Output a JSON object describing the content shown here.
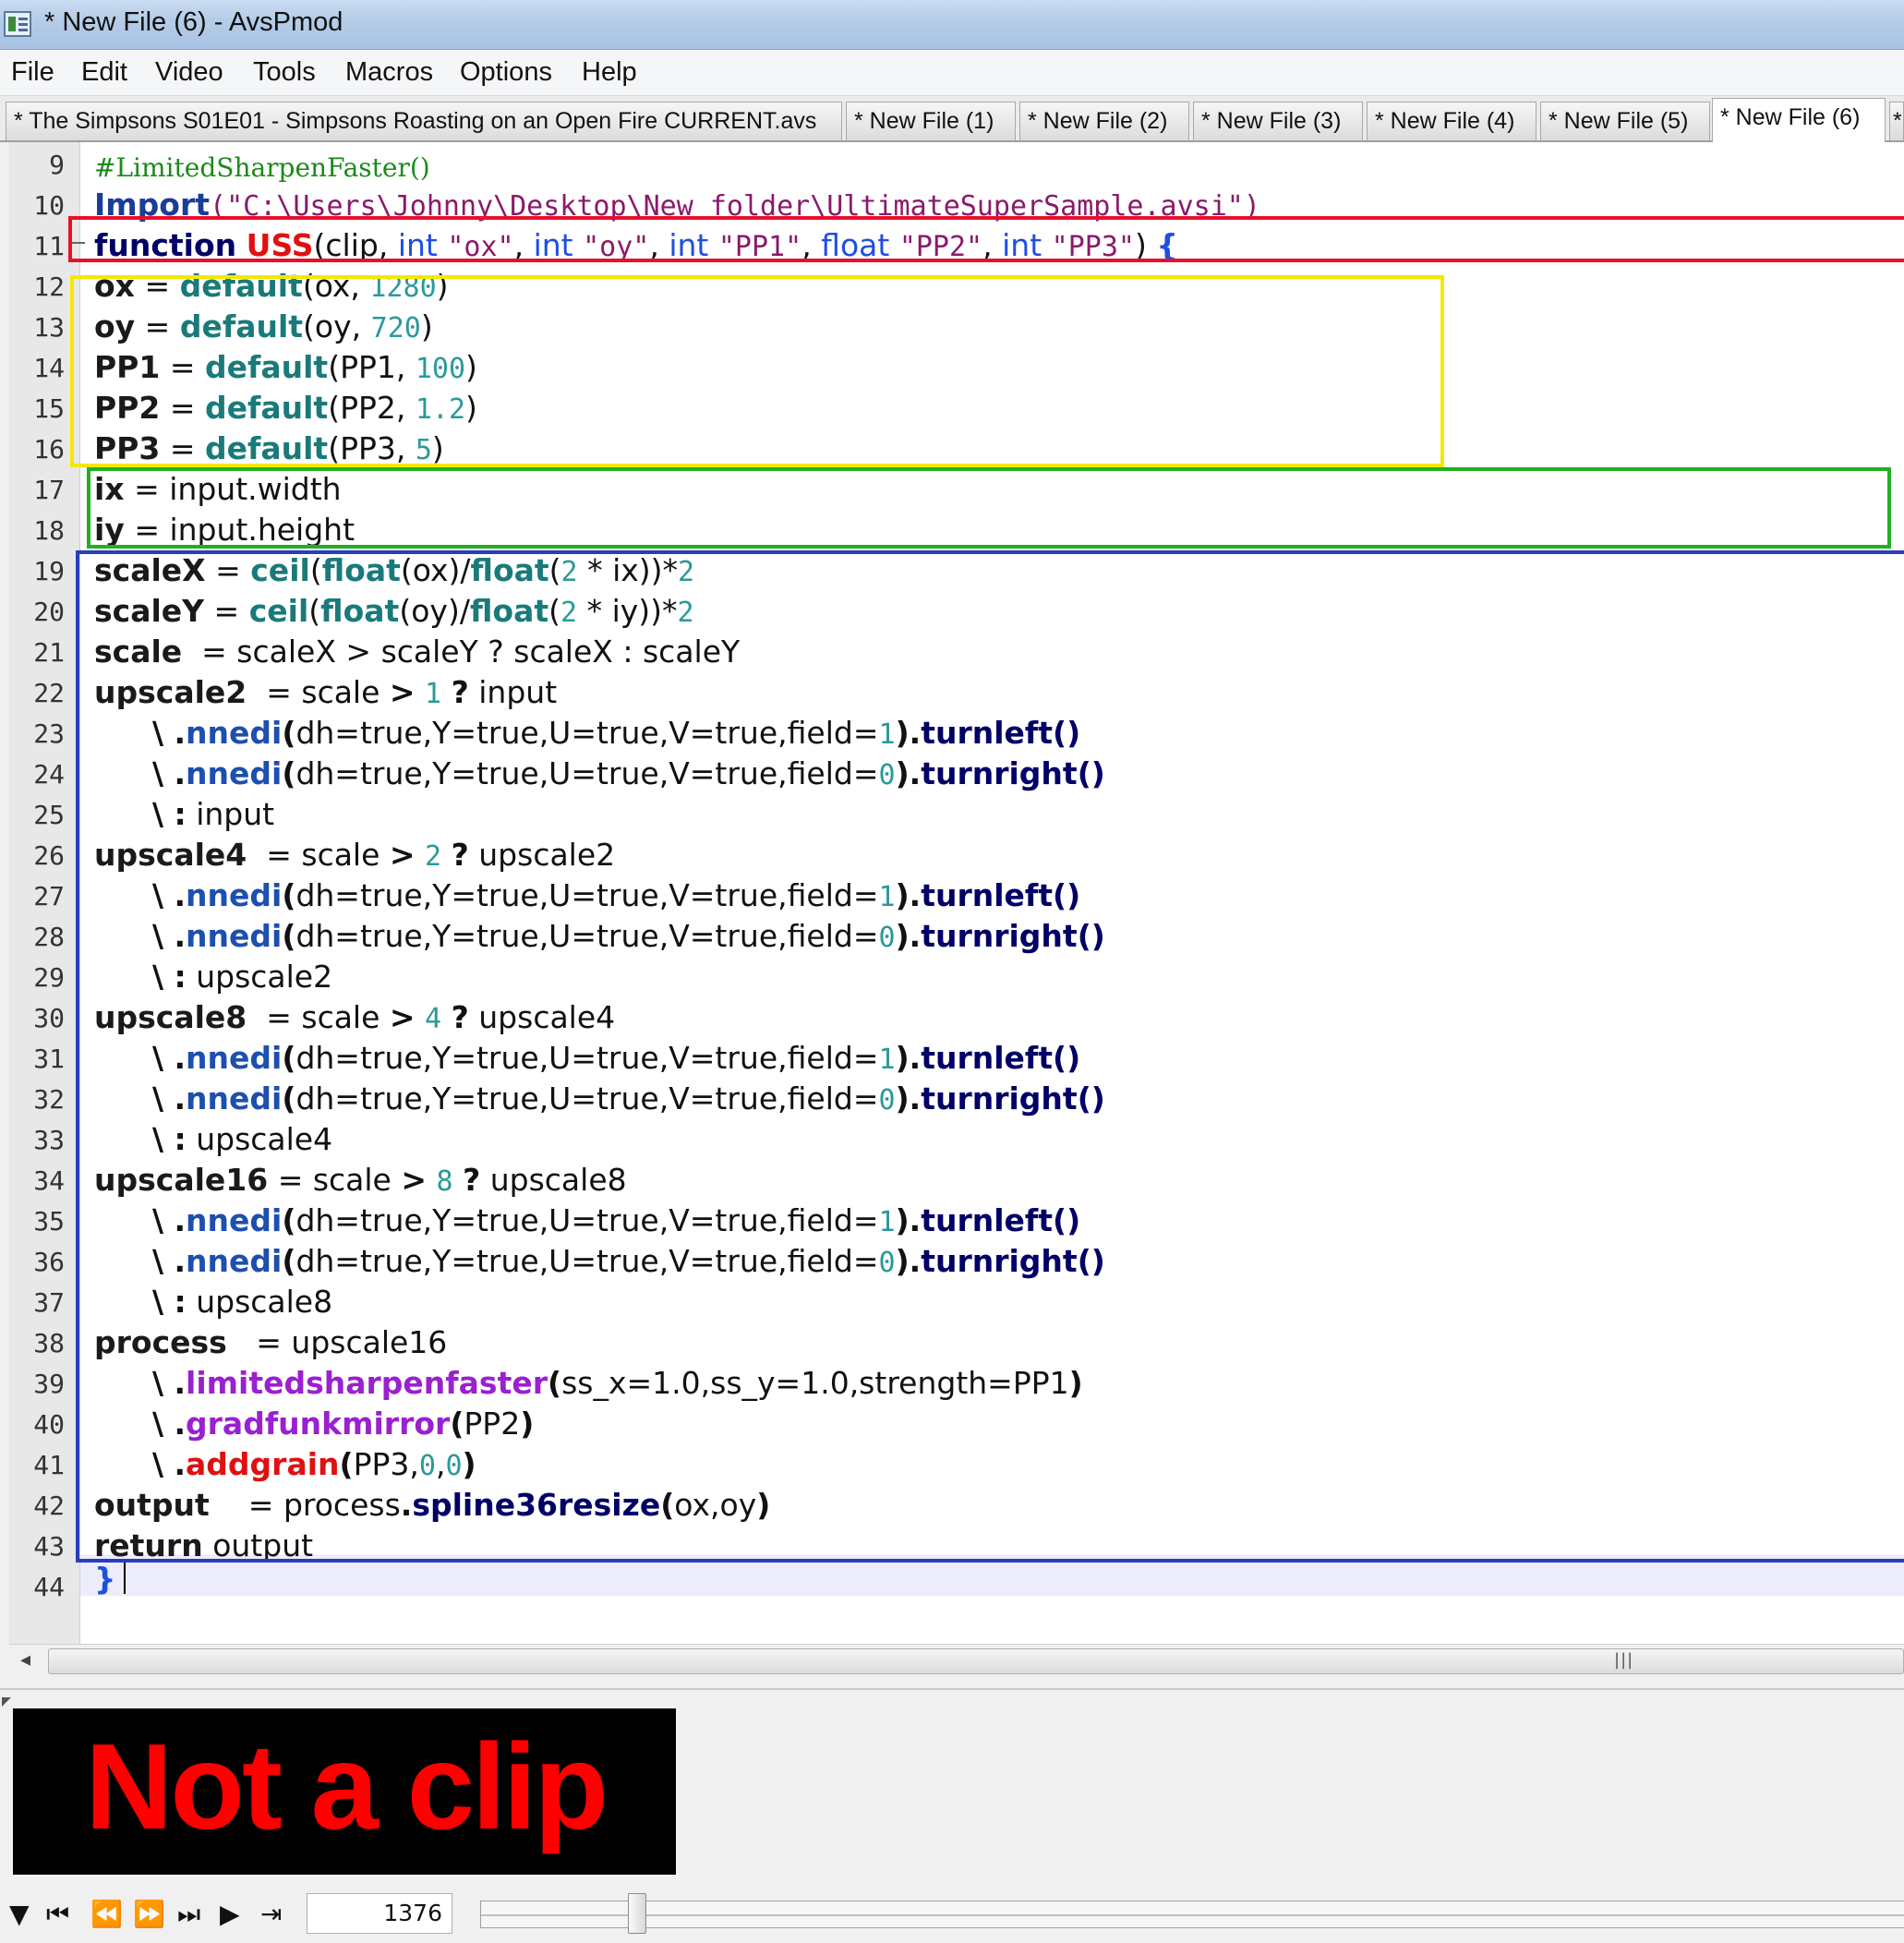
{
  "window": {
    "title": "* New File (6) - AvsPmod"
  },
  "menu": [
    "File",
    "Edit",
    "Video",
    "Tools",
    "Macros",
    "Options",
    "Help"
  ],
  "tabs": [
    "* The Simpsons S01E01 - Simpsons Roasting on an Open Fire  CURRENT.avs",
    "* New File (1)",
    "* New File (2)",
    "* New File (3)",
    "* New File (4)",
    "* New File (5)",
    "* New File (6)",
    "* "
  ],
  "active_tab_index": 6,
  "editor": {
    "line_numbers": [
      "9",
      "10",
      "11",
      "12",
      "13",
      "14",
      "15",
      "16",
      "17",
      "18",
      "19",
      "20",
      "21",
      "22",
      "23",
      "24",
      "25",
      "26",
      "27",
      "28",
      "29",
      "30",
      "31",
      "32",
      "33",
      "34",
      "35",
      "36",
      "37",
      "38",
      "39",
      "40",
      "41",
      "42",
      "43",
      "44"
    ],
    "code": {
      "l9_comment": "#LimitedSharpenFaster()",
      "l10_import": "Import",
      "l10_path": "(\"C:\\Users\\Johnny\\Desktop\\New folder\\UltimateSuperSample.avsi\")",
      "l11_function": "function",
      "l11_name": "USS",
      "l11_clip": "(clip, ",
      "l11_int": "int",
      "l11_ox": "\"ox\"",
      "l11_oy": "\"oy\"",
      "l11_pp1": "\"PP1\"",
      "l11_float": "float",
      "l11_pp2": "\"PP2\"",
      "l11_pp3": "\"PP3\"",
      "l11_brace": "{",
      "default_fn": "default",
      "ox": "ox",
      "oy": "oy",
      "pp1": "PP1",
      "pp2": "PP2",
      "pp3": "PP3",
      "v1280": "1280",
      "v720": "720",
      "v100": "100",
      "v12": "1.2",
      "v5": "5",
      "ix": "ix",
      "iy": "iy",
      "input_width": "input.width",
      "input_height": "input.height",
      "scaleX": "scaleX",
      "scaleY": "scaleY",
      "scale": "scale",
      "ceil": "ceil",
      "float_fn": "float",
      "two": "2",
      "ternary_scale": "scaleX > scaleY ? scaleX : scaleY",
      "upscale2": "upscale2",
      "upscale4": "upscale4",
      "upscale8": "upscale8",
      "upscale16": "upscale16",
      "input": "input",
      "nnedi": "nnedi",
      "nnedi_args": "dh=true,Y=true,U=true,V=true,field=",
      "turnleft": "turnleft()",
      "turnright": "turnright()",
      "process": "process",
      "limitedsharpenfaster": "limitedsharpenfaster",
      "lsf_args": "ss_x=1.0,ss_y=1.0,strength=PP1",
      "gradfunkmirror": "gradfunkmirror",
      "addgrain": "addgrain",
      "output": "output",
      "spline": "spline36resize",
      "return": "return",
      "close_brace": "}"
    },
    "highlight_colors": {
      "red": "#e8102a",
      "yellow": "#f5e800",
      "green": "#22b022",
      "blue": "#2a3cc0"
    }
  },
  "preview": {
    "message": "Not a clip"
  },
  "toolbar": {
    "icons": [
      "triangle-down-icon",
      "skip-start-icon",
      "step-back-icon",
      "step-forward-icon",
      "skip-end-icon",
      "play-icon",
      "goto-icon"
    ],
    "frame": "1376",
    "slider_position": 0.11
  }
}
